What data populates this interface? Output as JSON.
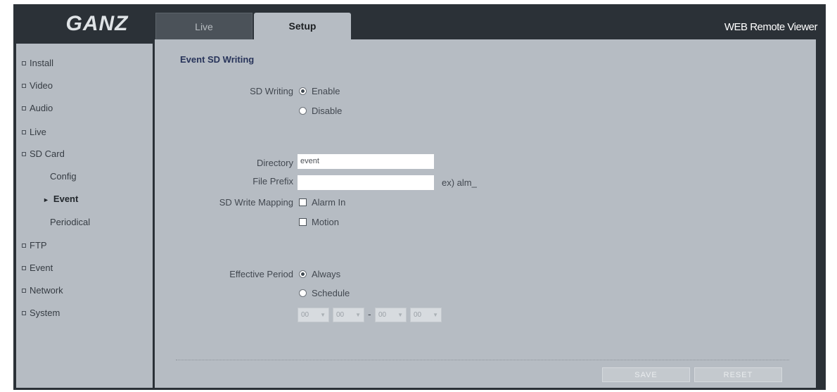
{
  "header": {
    "logo": "GANZ",
    "tabs": [
      {
        "label": "Live",
        "active": false
      },
      {
        "label": "Setup",
        "active": true
      }
    ],
    "brand": "WEB Remote Viewer"
  },
  "sidebar": {
    "items": [
      {
        "label": "Install"
      },
      {
        "label": "Video"
      },
      {
        "label": "Audio"
      },
      {
        "label": "Live"
      },
      {
        "label": "SD Card",
        "expanded": true
      },
      {
        "label": "FTP"
      },
      {
        "label": "Event"
      },
      {
        "label": "Network"
      },
      {
        "label": "System"
      }
    ],
    "sd_card_sub": [
      {
        "label": "Config",
        "active": false
      },
      {
        "label": "Event",
        "active": true
      },
      {
        "label": "Periodical",
        "active": false
      }
    ]
  },
  "main": {
    "title": "Event SD Writing",
    "sd_writing": {
      "label": "SD Writing",
      "options": [
        {
          "label": "Enable",
          "selected": true
        },
        {
          "label": "Disable",
          "selected": false
        }
      ]
    },
    "directory": {
      "label": "Directory",
      "value": "event"
    },
    "file_prefix": {
      "label": "File Prefix",
      "value": "",
      "hint": "ex) alm_"
    },
    "sd_write_mapping": {
      "label": "SD Write Mapping",
      "options": [
        {
          "label": "Alarm In",
          "checked": false
        },
        {
          "label": "Motion",
          "checked": false
        }
      ]
    },
    "effective_period": {
      "label": "Effective Period",
      "options": [
        {
          "label": "Always",
          "selected": true
        },
        {
          "label": "Schedule",
          "selected": false
        }
      ],
      "start_hour": "00",
      "start_minute": "00",
      "separator": "-",
      "end_hour": "00",
      "end_minute": "00"
    },
    "buttons": {
      "save": "SAVE",
      "reset": "RESET"
    }
  },
  "colors": {
    "frame": "#2b3137",
    "panel": "#b6bcc3",
    "title": "#28345a"
  }
}
